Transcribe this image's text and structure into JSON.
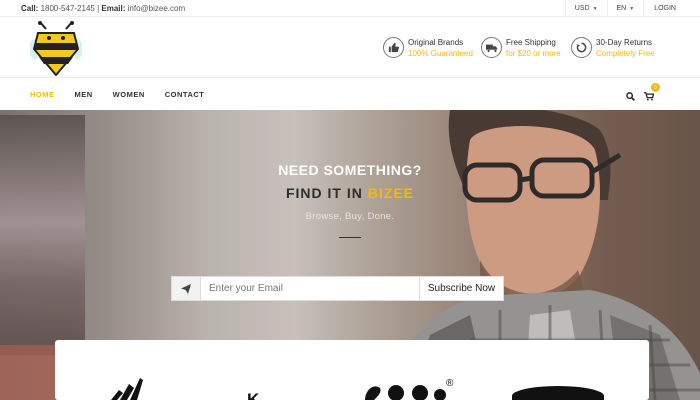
{
  "topbar": {
    "call_label": "Call:",
    "phone": "1800-547-2145",
    "separator": "|",
    "email_label": "Email:",
    "email": "info@bizee.com",
    "currency": "USD",
    "language": "EN",
    "login": "LOGIN"
  },
  "features": [
    {
      "title": "Original Brands",
      "subtitle": "100% Guaranteed",
      "icon": "thumbs-up-icon"
    },
    {
      "title": "Free Shipping",
      "subtitle": "for $20 or more",
      "icon": "truck-icon"
    },
    {
      "title": "30-Day Returns",
      "subtitle": "Completely Free",
      "icon": "return-icon"
    }
  ],
  "nav": {
    "items": [
      "HOME",
      "MEN",
      "WOMEN",
      "CONTACT"
    ],
    "active_index": 0,
    "cart_count": "0"
  },
  "hero": {
    "line1": "NEED SOMETHING?",
    "line2_prefix": "FIND IT IN",
    "line2_brand": "BIZEE",
    "line3": "Browse, Buy, Done."
  },
  "subscribe": {
    "placeholder": "Enter your Email",
    "button": "Subscribe Now"
  },
  "brands": {
    "kappa_partial": "K",
    "registered": "®"
  },
  "colors": {
    "accent": "#f6b80c",
    "text": "#333333"
  }
}
